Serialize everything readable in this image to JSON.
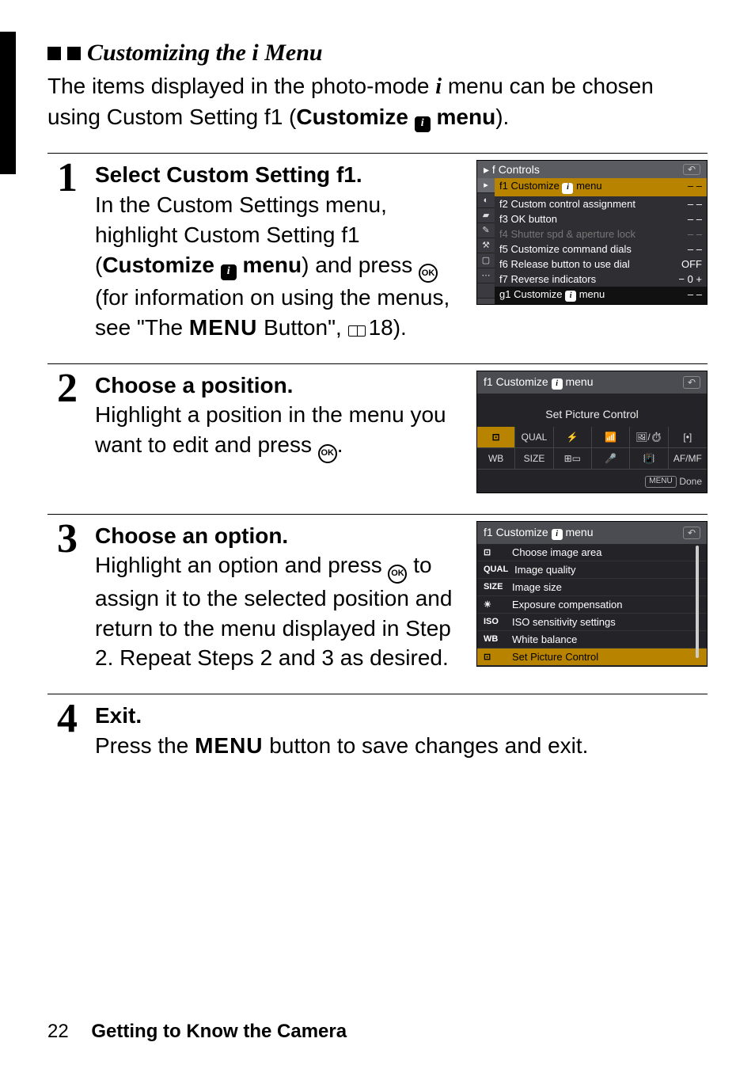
{
  "heading": {
    "prefix": "Customizing the",
    "suffix": "Menu"
  },
  "intro": {
    "part1": "The items displayed in the photo-mode ",
    "part2": " menu can be chosen using Custom Setting f1 (",
    "cs_label_bold": "Customize ",
    "cs_label_bold2": " menu",
    "close": ")."
  },
  "steps": {
    "s1": {
      "num": "1",
      "title": "Select Custom Setting f1.",
      "line1": "In the Custom Settings menu, highlight Custom Setting f1 (",
      "bold1": "Customize ",
      "bold2": " menu",
      "line2": ") and press ",
      "line3": " (for information on using the menus, see \"The ",
      "menu_word": "MENU",
      "line4": " Button\", ",
      "pageref": "18)."
    },
    "s2": {
      "num": "2",
      "title": "Choose a position.",
      "body1": "Highlight a position in the menu you want to edit and press ",
      "body2": "."
    },
    "s3": {
      "num": "3",
      "title": "Choose an option.",
      "body1": "Highlight an option and press ",
      "body2": " to assign it to the selected position and return to the menu displayed in Step 2. Repeat Steps 2 and 3 as desired."
    },
    "s4": {
      "num": "4",
      "title": "Exit.",
      "body1": "Press the ",
      "menu_word": "MENU",
      "body2": " button to save changes and exit."
    }
  },
  "panel1": {
    "head": "f  Controls",
    "rows": [
      {
        "l": "f1 Customize ",
        "badge": true,
        "l2": " menu",
        "v": "– –",
        "hi": true
      },
      {
        "l": "f2 Custom control assignment",
        "v": "– –"
      },
      {
        "l": "f3 OK button",
        "v": "– –"
      },
      {
        "l": "f4 Shutter spd & aperture lock",
        "v": "– –",
        "dim": true
      },
      {
        "l": "f5 Customize command dials",
        "v": "– –"
      },
      {
        "l": "f6 Release button to use dial",
        "v": "OFF"
      },
      {
        "l": "f7 Reverse indicators",
        "v": "− 0 +"
      }
    ],
    "foot": {
      "l": "g1 Customize ",
      "badge": true,
      "l2": " menu",
      "v": "– –"
    }
  },
  "panel2": {
    "head": "f1 Customize ",
    "head2": " menu",
    "title": "Set Picture Control",
    "row1": [
      "⊡",
      "QUAL",
      "⚡",
      "📶",
      "🖼/⏱",
      "[•]"
    ],
    "row2": [
      "WB",
      "SIZE",
      "⊞▭",
      "🎤",
      "📳",
      "AF/MF"
    ],
    "done": "Done"
  },
  "panel3": {
    "head": "f1 Customize ",
    "head2": " menu",
    "rows": [
      {
        "t": "⊡",
        "l": "Choose image area"
      },
      {
        "t": "QUAL",
        "l": "Image quality"
      },
      {
        "t": "SIZE",
        "l": "Image size"
      },
      {
        "t": "☀",
        "l": "Exposure compensation"
      },
      {
        "t": "ISO",
        "l": "ISO sensitivity settings"
      },
      {
        "t": "WB",
        "l": "White balance"
      },
      {
        "t": "⊡",
        "l": "Set Picture Control",
        "hi": true
      }
    ]
  },
  "footer": {
    "page": "22",
    "section": "Getting to Know the Camera"
  },
  "ok_label": "OK",
  "menu_pill": "MENU"
}
